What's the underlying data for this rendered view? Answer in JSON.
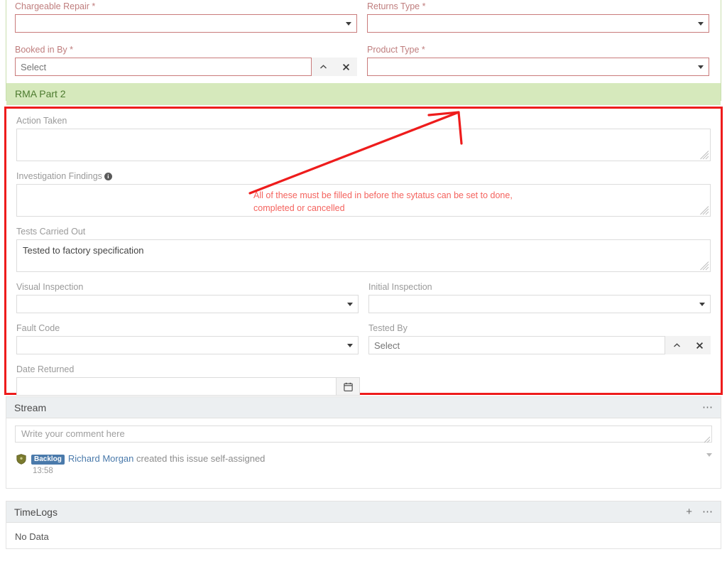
{
  "top_form": {
    "fields": [
      {
        "label": "Chargeable Repair *",
        "type": "select",
        "value": "",
        "required": true
      },
      {
        "label": "Returns Type *",
        "type": "select",
        "value": "",
        "required": true
      },
      {
        "label": "Booked in By *",
        "type": "lookup",
        "value": "",
        "placeholder": "Select",
        "required": true
      },
      {
        "label": "Product Type *",
        "type": "select",
        "value": "",
        "required": true
      }
    ]
  },
  "section": {
    "title": "RMA Part 2"
  },
  "rma_part2": {
    "action_taken": {
      "label": "Action Taken",
      "value": ""
    },
    "investigation_findings": {
      "label": "Investigation Findings",
      "value": "",
      "info_icon": "info-icon"
    },
    "tests_carried_out": {
      "label": "Tests Carried Out",
      "value": "Tested to factory specification"
    },
    "visual_inspection": {
      "label": "Visual Inspection",
      "value": ""
    },
    "initial_inspection": {
      "label": "Initial Inspection",
      "value": ""
    },
    "fault_code": {
      "label": "Fault Code",
      "value": ""
    },
    "tested_by": {
      "label": "Tested By",
      "value": "",
      "placeholder": "Select"
    },
    "date_returned": {
      "label": "Date Returned",
      "value": "",
      "icon": "calendar-icon"
    }
  },
  "annotation": {
    "line1": "All of these must be filled in before the sytatus can be set to done,",
    "line2": "completed or cancelled",
    "color": "#f4635e",
    "box_color": "#ee1c1c"
  },
  "stream": {
    "title": "Stream",
    "menu_icon": "ellipsis-icon",
    "comment_placeholder": "Write your comment here",
    "comment_value": "",
    "items": [
      {
        "icon": "shield-icon",
        "badge": "Backlog",
        "user": "Richard Morgan",
        "text": "created this issue self-assigned",
        "time": "13:58",
        "chevron": "chevron-down-icon"
      }
    ]
  },
  "timelogs": {
    "title": "TimeLogs",
    "add_icon": "plus-icon",
    "menu_icon": "ellipsis-icon",
    "empty_text": "No Data"
  },
  "colors": {
    "section_bg": "#d6e9bc",
    "section_text": "#4c7a2e",
    "required_label": "#bf7d7d",
    "error_border": "#c97b7b",
    "annotation": "#ee1c1c",
    "badge": "#4a7aab"
  }
}
